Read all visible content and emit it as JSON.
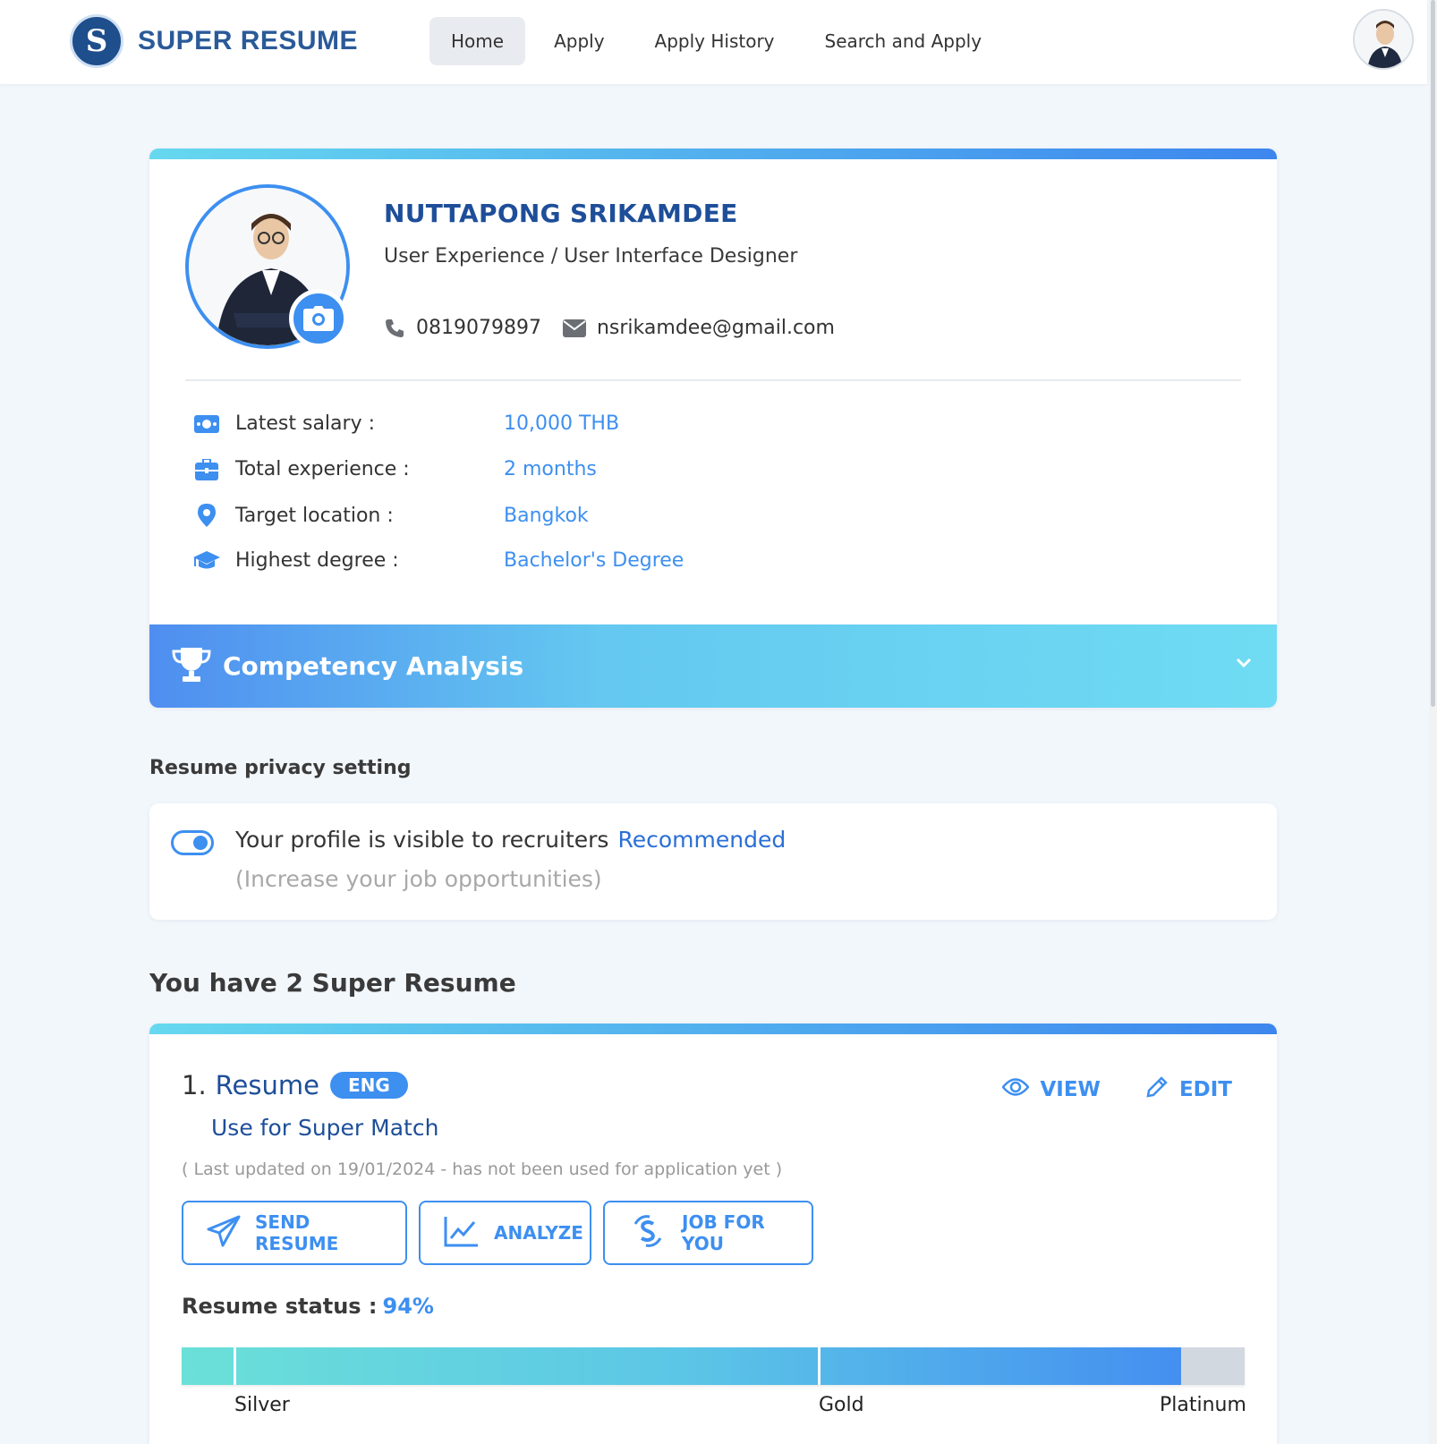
{
  "brand": {
    "name": "SUPER RESUME",
    "logo_letter": "S"
  },
  "nav": {
    "items": [
      {
        "label": "Home",
        "active": true
      },
      {
        "label": "Apply",
        "active": false
      },
      {
        "label": "Apply History",
        "active": false
      },
      {
        "label": "Search and Apply",
        "active": false
      }
    ]
  },
  "profile": {
    "name": "NUTTAPONG SRIKAMDEE",
    "title": "User Experience / User Interface Designer",
    "phone": "0819079897",
    "email": "nsrikamdee@gmail.com",
    "details": [
      {
        "icon": "money-icon",
        "label": "Latest salary :",
        "value": "10,000 THB"
      },
      {
        "icon": "briefcase-icon",
        "label": "Total experience :",
        "value": "2 months"
      },
      {
        "icon": "location-pin-icon",
        "label": "Target location :",
        "value": "Bangkok"
      },
      {
        "icon": "graduation-cap-icon",
        "label": "Highest degree :",
        "value": "Bachelor's Degree"
      }
    ],
    "competency_title": "Competency Analysis"
  },
  "privacy": {
    "section_label": "Resume privacy setting",
    "visible_text": "Your profile is visible to recruiters",
    "recommended": "Recommended",
    "sub_text": "(Increase your job opportunities)",
    "enabled": true
  },
  "resumes": {
    "count_text": "You have 2 Super Resume",
    "items": [
      {
        "number": "1.",
        "name": "Resume",
        "language": "ENG",
        "subtitle": "Use for Super Match",
        "updated": "( Last updated on 19/01/2024 - has not been used for application yet )",
        "view_label": "VIEW",
        "edit_label": "EDIT",
        "buttons": [
          "SEND RESUME",
          "ANALYZE",
          "JOB FOR YOU"
        ],
        "status_label": "Resume status :",
        "status_value": "94%",
        "progress_fraction": 0.94,
        "levels": [
          "Silver",
          "Gold",
          "Platinum"
        ]
      }
    ]
  },
  "colors": {
    "accent": "#3d8ff0",
    "brand_dark": "#1e4e99",
    "background": "#f2f7fc"
  }
}
